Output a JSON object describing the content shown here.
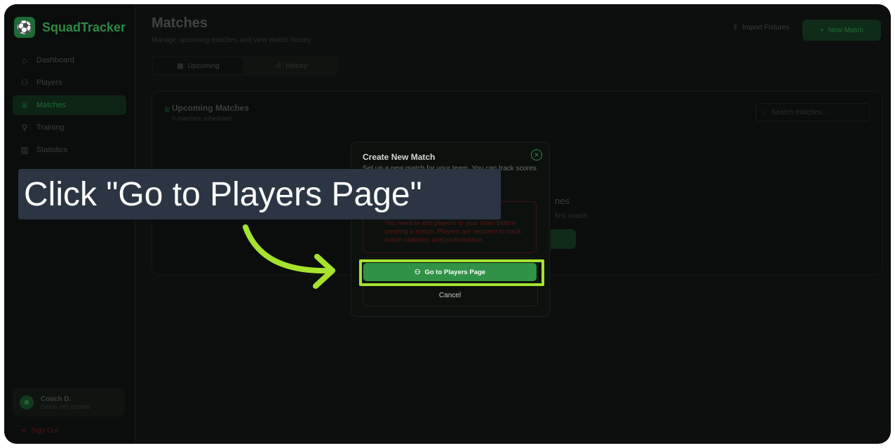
{
  "app": {
    "name": "SquadTracker",
    "logo_icon": "soccer-ball-icon"
  },
  "sidebar": {
    "items": [
      {
        "label": "Dashboard",
        "icon": "home-icon"
      },
      {
        "label": "Players",
        "icon": "users-icon"
      },
      {
        "label": "Matches",
        "icon": "trophy-icon",
        "active": true
      },
      {
        "label": "Training",
        "icon": "training-icon"
      },
      {
        "label": "Statistics",
        "icon": "bar-chart-icon"
      }
    ],
    "user": {
      "name": "Coach D.",
      "role": "Demo info posted"
    },
    "signout_label": "Sign Out"
  },
  "header": {
    "title": "Matches",
    "subtitle": "Manage upcoming matches and view match history",
    "import_label": "Import Fixtures",
    "new_match_label": "New Match"
  },
  "tabs": [
    {
      "label": "Upcoming",
      "active": true
    },
    {
      "label": "History",
      "active": false
    }
  ],
  "panel": {
    "title": "Upcoming Matches",
    "subtitle": "0 matches scheduled",
    "search_placeholder": "Search matches...",
    "empty_title": "nes",
    "empty_sub": "first match."
  },
  "modal": {
    "title": "Create New Match",
    "description": "Set up a new match for your team. You can track scores",
    "alert_text": "You need to add players to your team before creating a match. Players are required to track match statistics and performance.",
    "go_players_label": "Go to Players Page",
    "cancel_label": "Cancel"
  },
  "annotation": {
    "callout_text": "Click \"Go to Players Page\"",
    "highlight_color": "#a6e22e",
    "callout_bg": "#2b3544"
  }
}
